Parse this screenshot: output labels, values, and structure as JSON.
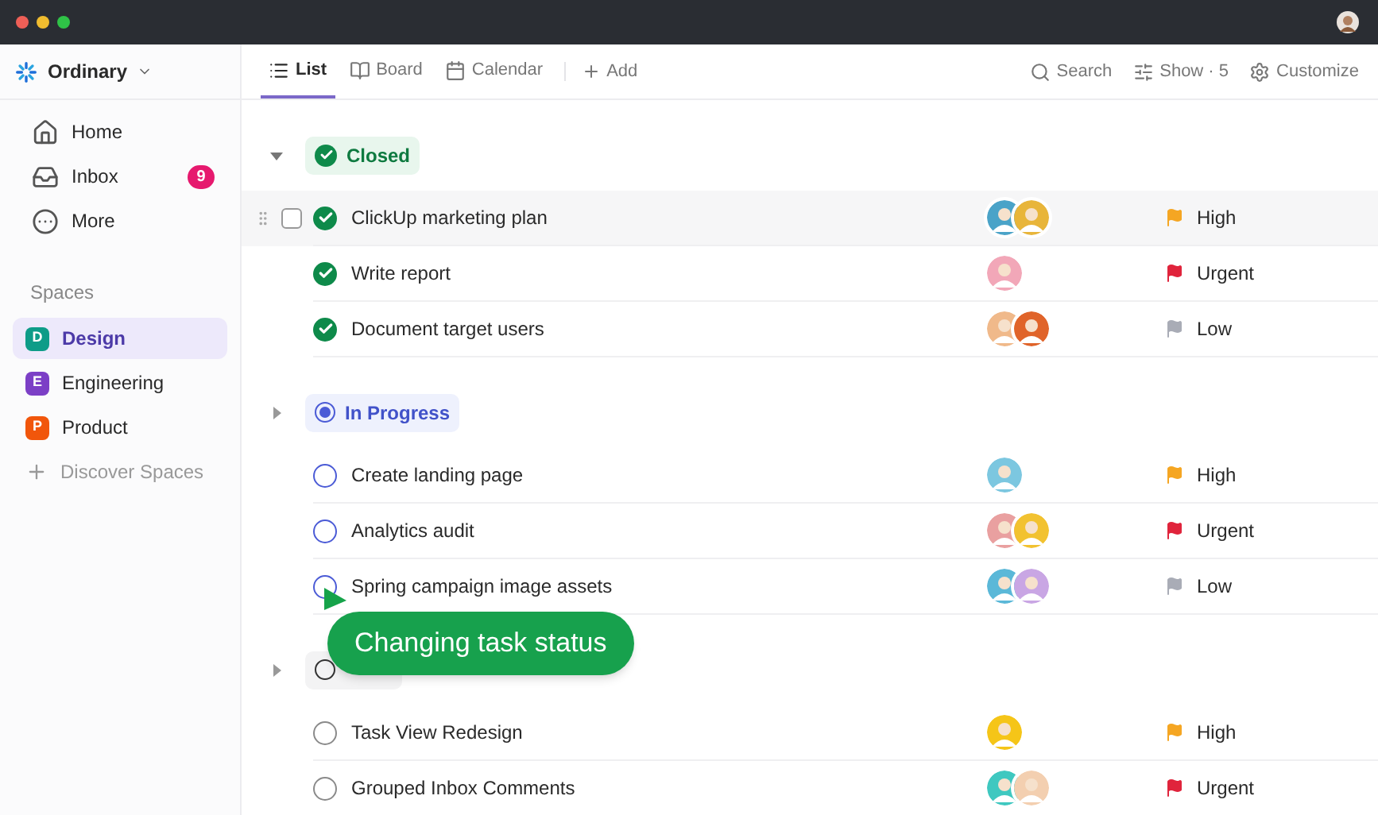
{
  "workspace": {
    "name": "Ordinary"
  },
  "sidebar": {
    "items": [
      {
        "kind": "home",
        "label": "Home"
      },
      {
        "kind": "inbox",
        "label": "Inbox",
        "badge": "9"
      },
      {
        "kind": "more",
        "label": "More"
      }
    ],
    "spaces_label": "Spaces",
    "spaces": [
      {
        "letter": "D",
        "label": "Design",
        "color": "#0e9c88",
        "selected": true
      },
      {
        "letter": "E",
        "label": "Engineering",
        "color": "#7c3fc6",
        "selected": false
      },
      {
        "letter": "P",
        "label": "Product",
        "color": "#f1560b",
        "selected": false
      }
    ],
    "discover": "Discover Spaces"
  },
  "tabs": [
    {
      "kind": "list",
      "label": "List",
      "selected": true
    },
    {
      "kind": "board",
      "label": "Board",
      "selected": false
    },
    {
      "kind": "calendar",
      "label": "Calendar",
      "selected": false
    }
  ],
  "add_view": "Add",
  "toolbar": [
    {
      "kind": "search",
      "label": "Search"
    },
    {
      "kind": "show",
      "label": "Show · 5"
    },
    {
      "kind": "customize",
      "label": "Customize"
    }
  ],
  "groups": [
    {
      "kind": "closed",
      "label": "Closed",
      "expanded": true,
      "tasks": [
        {
          "name": "ClickUp marketing plan",
          "hovered": true,
          "assignees": [
            {
              "color": "#4aa3c8"
            },
            {
              "color": "#e8b53a"
            }
          ],
          "priority": "High",
          "color": "#f5a623"
        },
        {
          "name": "Write report",
          "hovered": false,
          "assignees": [
            {
              "color": "#f2a7b8"
            }
          ],
          "priority": "Urgent",
          "color": "#e0243c"
        },
        {
          "name": "Document target users",
          "hovered": false,
          "assignees": [
            {
              "color": "#f0b98a"
            },
            {
              "color": "#e0642a"
            }
          ],
          "priority": "Low",
          "color": "#a9acb6"
        }
      ]
    },
    {
      "kind": "in_progress",
      "label": "In Progress",
      "expanded": false,
      "tasks": [
        {
          "name": "Create landing page",
          "hovered": false,
          "assignees": [
            {
              "color": "#7cc7e0"
            }
          ],
          "priority": "High",
          "color": "#f5a623"
        },
        {
          "name": "Analytics audit",
          "hovered": false,
          "assignees": [
            {
              "color": "#e9a0a0"
            },
            {
              "color": "#f2c230"
            }
          ],
          "priority": "Urgent",
          "color": "#e0243c"
        },
        {
          "name": "Spring campaign image assets",
          "hovered": false,
          "assignees": [
            {
              "color": "#5bb8d8"
            },
            {
              "color": "#c9a6e4"
            }
          ],
          "priority": "Low",
          "color": "#a9acb6"
        }
      ]
    },
    {
      "kind": "todo",
      "expanded": false,
      "tasks": [
        {
          "name": "Task View Redesign",
          "hovered": false,
          "assignees": [
            {
              "color": "#f5c518"
            }
          ],
          "priority": "High",
          "color": "#f5a623"
        },
        {
          "name": "Grouped Inbox Comments",
          "hovered": false,
          "assignees": [
            {
              "color": "#3fc8c0"
            },
            {
              "color": "#f3cfb0"
            }
          ],
          "priority": "Urgent",
          "color": "#e0243c"
        }
      ]
    }
  ],
  "callout": "Changing task status"
}
